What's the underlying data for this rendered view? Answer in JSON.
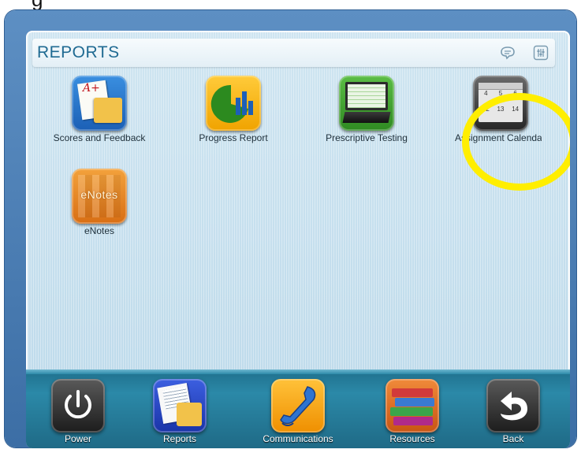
{
  "top_clipped_text": "g",
  "header": {
    "title": "REPORTS"
  },
  "tiles": [
    {
      "label": "Scores and Feedback"
    },
    {
      "label": "Progress Report"
    },
    {
      "label": "Prescriptive Testing"
    },
    {
      "label": "Assignment Calenda"
    },
    {
      "label": "eNotes"
    }
  ],
  "calendar_icon": {
    "numbers": [
      "4",
      "5",
      "6",
      "12",
      "13",
      "14"
    ]
  },
  "enotes_icon_text": "eNotes",
  "grade_text": "A+",
  "dock": [
    {
      "label": "Power"
    },
    {
      "label": "Reports"
    },
    {
      "label": "Communications"
    },
    {
      "label": "Resources"
    },
    {
      "label": "Back"
    }
  ],
  "colors": {
    "frame": "#3c6ea5",
    "title": "#1f6a92",
    "highlight_ring": "#ffee00",
    "dock_bar": "#2b89a8"
  }
}
